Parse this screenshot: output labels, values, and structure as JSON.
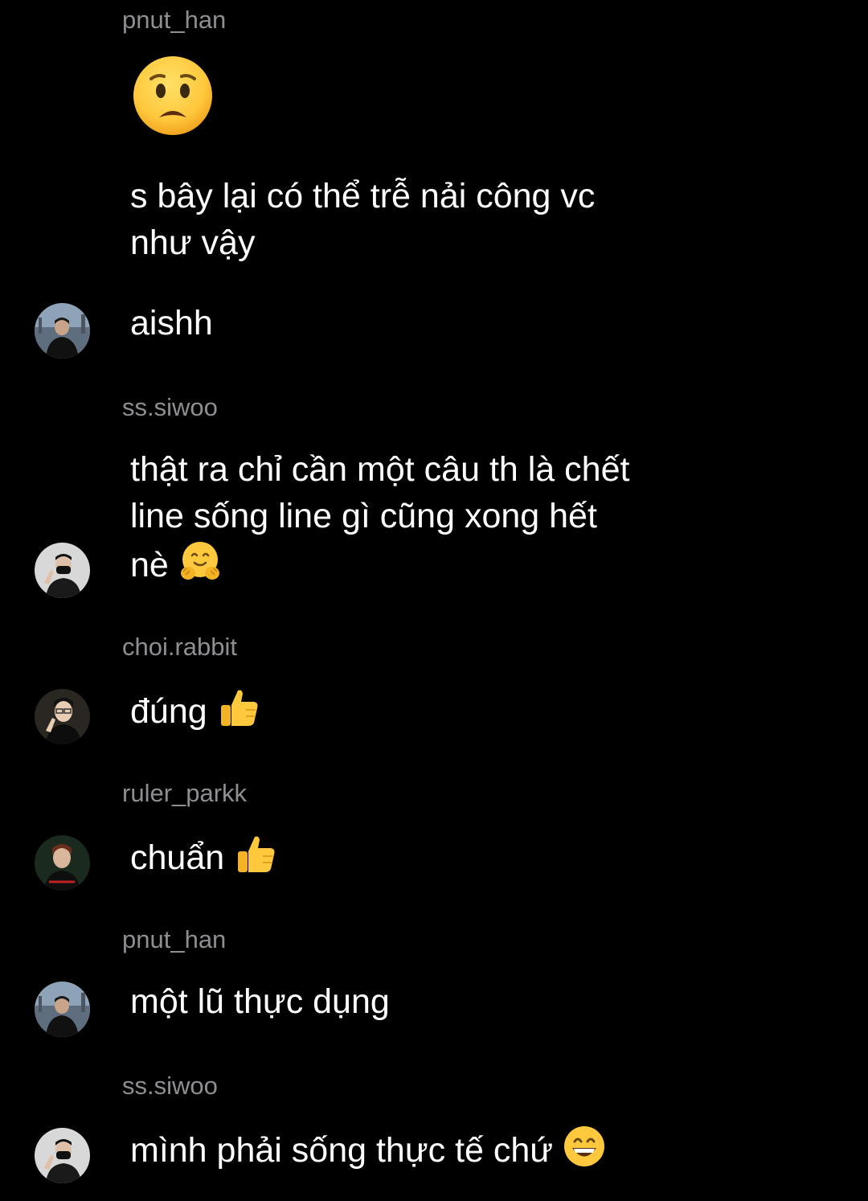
{
  "thread": [
    {
      "type": "sender",
      "name": "pnut_han"
    },
    {
      "type": "emoji",
      "emoji": "anguished-face"
    },
    {
      "type": "message",
      "lines": [
        "s bây lại có thể trễ nải công vc",
        "như vậy"
      ]
    },
    {
      "type": "message",
      "lines": [
        "aishh"
      ],
      "avatar": "pnut_han-avatar"
    },
    {
      "type": "sender",
      "name": "ss.siwoo"
    },
    {
      "type": "message",
      "lines": [
        "thật ra chỉ cần một câu th là chết",
        "line sống line gì cũng xong hết",
        "nè"
      ],
      "trailing_emoji": "hugging-face",
      "avatar": "ss.siwoo-avatar"
    },
    {
      "type": "sender",
      "name": "choi.rabbit"
    },
    {
      "type": "message",
      "lines": [
        "đúng"
      ],
      "trailing_emoji": "thumbs-up",
      "avatar": "choi.rabbit-avatar"
    },
    {
      "type": "sender",
      "name": "ruler_parkk"
    },
    {
      "type": "message",
      "lines": [
        "chuẩn"
      ],
      "trailing_emoji": "thumbs-up",
      "avatar": "ruler_parkk-avatar"
    },
    {
      "type": "sender",
      "name": "pnut_han"
    },
    {
      "type": "message",
      "lines": [
        "một lũ thực dụng"
      ],
      "avatar": "pnut_han-avatar"
    },
    {
      "type": "sender",
      "name": "ss.siwoo"
    },
    {
      "type": "message",
      "lines": [
        "mình phải sống thực tế chứ"
      ],
      "trailing_emoji": "grinning-face",
      "avatar": "ss.siwoo-avatar"
    }
  ],
  "colors": {
    "background": "#000000",
    "sender_text": "#8e8e93",
    "message_text": "#ffffff",
    "emoji_yellow": "#ffc83d"
  }
}
